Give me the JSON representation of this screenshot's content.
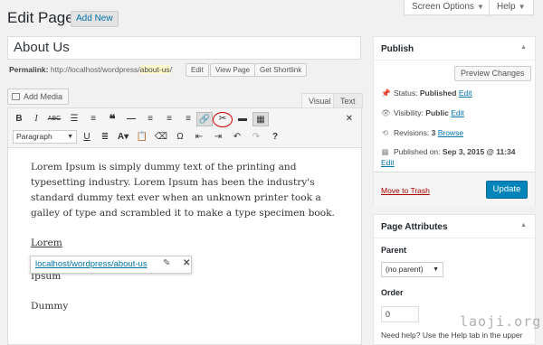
{
  "header": {
    "title": "Edit Page",
    "add_new": "Add New",
    "screen_options": "Screen Options",
    "help": "Help"
  },
  "post": {
    "title": "About Us",
    "permalink_label": "Permalink:",
    "permalink_base": "http://localhost/wordpress/",
    "permalink_slug": "about-us",
    "permalink_tail": "/",
    "edit_btn": "Edit",
    "view_page_btn": "View Page",
    "shortlink_btn": "Get Shortlink"
  },
  "editor": {
    "add_media": "Add Media",
    "tab_visual": "Visual",
    "tab_text": "Text",
    "paragraph_format": "Paragraph",
    "toolbar_row1_icons": [
      "bold-icon",
      "italic-icon",
      "strikethrough-icon",
      "bullet-list-icon",
      "numbered-list-icon",
      "blockquote-icon",
      "horizontal-rule-icon",
      "align-left-icon",
      "align-center-icon",
      "align-right-icon",
      "insert-link-icon",
      "remove-link-icon",
      "read-more-icon",
      "toolbar-toggle-icon",
      "fullscreen-icon"
    ],
    "toolbar_row2_icons": [
      "underline-icon",
      "justify-icon",
      "text-color-icon",
      "paste-text-icon",
      "clear-formatting-icon",
      "special-character-icon",
      "outdent-icon",
      "indent-icon",
      "undo-icon",
      "redo-icon",
      "help-icon"
    ],
    "paragraph1": "Lorem Ipsum is simply dummy text of the printing and typesetting industry. Lorem Ipsum has been the industry's standard dummy text ever when an unknown printer took a galley of type and scrambled it to make a type specimen book.",
    "linked_word": "Lorem",
    "line2": "Ipsum",
    "line3": "Dummy",
    "link_popup_url": "localhost/wordpress/about-us"
  },
  "publish": {
    "heading": "Publish",
    "preview_btn": "Preview Changes",
    "status_label": "Status:",
    "status_value": "Published",
    "visibility_label": "Visibility:",
    "visibility_value": "Public",
    "revisions_label": "Revisions:",
    "revisions_value": "3",
    "published_label": "Published on:",
    "published_value": "Sep 3, 2015 @ 11:34",
    "edit_link": "Edit",
    "browse_link": "Browse",
    "trash_link": "Move to Trash",
    "update_btn": "Update"
  },
  "attributes": {
    "heading": "Page Attributes",
    "parent_label": "Parent",
    "parent_value": "(no parent)",
    "order_label": "Order",
    "order_value": "0",
    "help_text": "Need help? Use the Help tab in the upper"
  },
  "watermark": "laoji.org",
  "colors": {
    "accent": "#0073aa",
    "primary_button": "#0085ba",
    "danger": "#a00000",
    "highlight_circle": "#d10000"
  }
}
